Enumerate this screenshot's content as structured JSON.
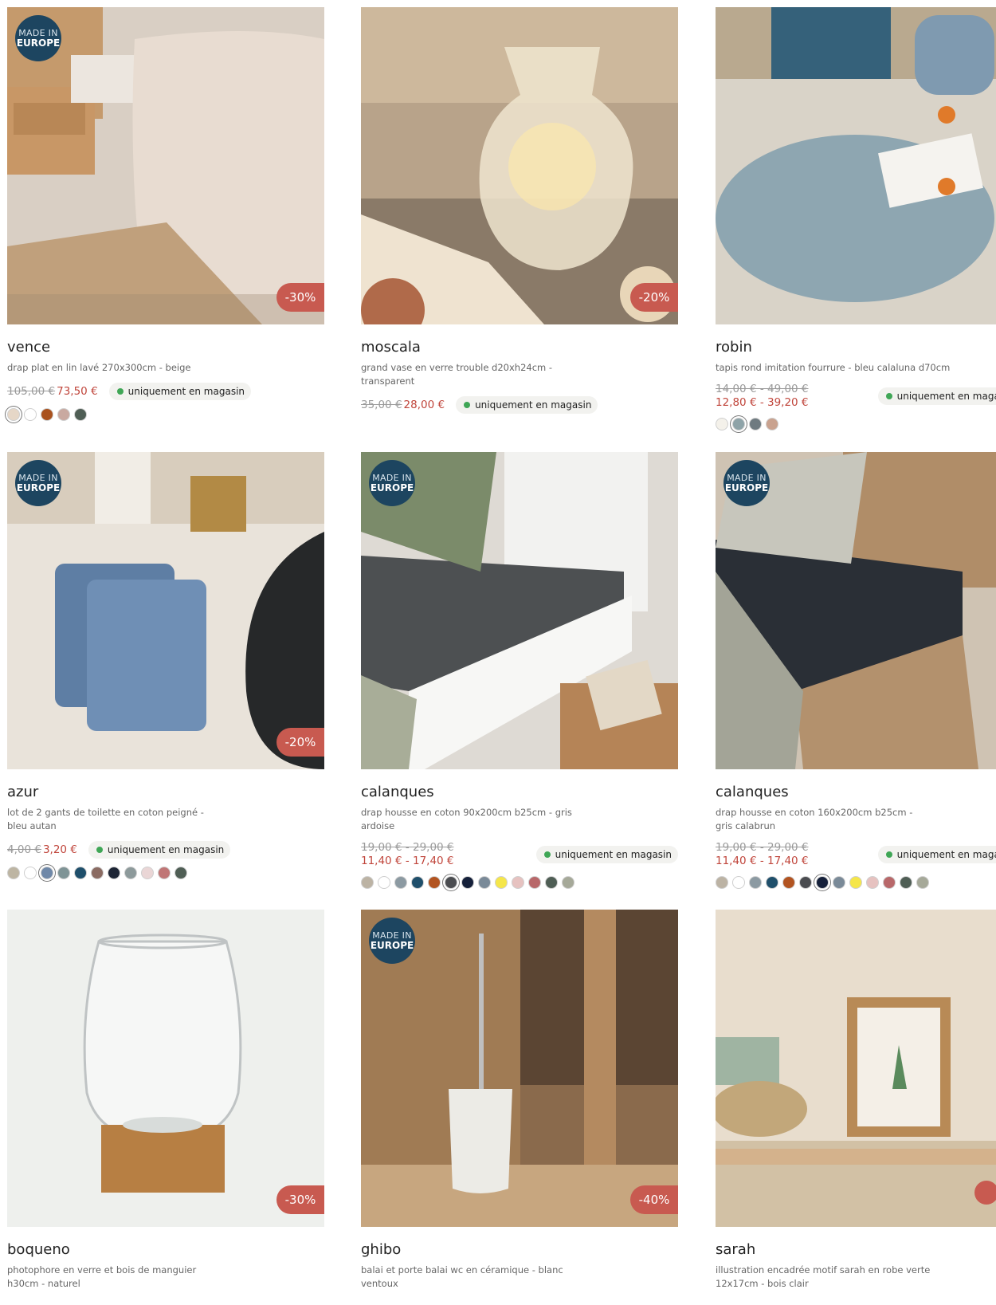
{
  "badges": {
    "made_line1": "MADE IN",
    "made_line2": "EUROPE"
  },
  "store_label": "uniquement en magasin",
  "products": [
    {
      "name": "vence",
      "desc": "drap plat en lin lavé 270x300cm - beige",
      "discount": "-30%",
      "old": "105,00 €",
      "new": "73,50 €",
      "made_in_europe": true,
      "store": true,
      "swatches": [
        "#e6d7c7",
        "#ffffff",
        "#a9521e",
        "#c9a9a0",
        "#4f5e55"
      ],
      "selected": 0
    },
    {
      "name": "moscala",
      "desc": "grand vase en verre trouble d20xh24cm - transparent",
      "discount": "-20%",
      "old": "35,00 €",
      "new": "28,00 €",
      "made_in_europe": false,
      "store": true,
      "swatches": []
    },
    {
      "name": "robin",
      "desc": "tapis rond imitation fourrure - bleu calaluna d70cm",
      "discount": "",
      "old": "14,00 € - 49,00 €",
      "new": "12,80 € - 39,20 €",
      "made_in_europe": false,
      "store": true,
      "swatches": [
        "#f4f1ea",
        "#8ea3a8",
        "#6e7a80",
        "#c9a28f"
      ],
      "selected": 1
    },
    {
      "name": "azur",
      "desc": "lot de 2 gants de toilette en coton peigné - bleu autan",
      "discount": "-20%",
      "old": "4,00 €",
      "new": "3,20 €",
      "made_in_europe": true,
      "store": true,
      "swatches": [
        "#bdb5a3",
        "#ffffff",
        "#6f88a8",
        "#7f9496",
        "#1f4f6b",
        "#8a6b62",
        "#1d2535",
        "#8d9a9b",
        "#ead6d6",
        "#c07676",
        "#4f5e55"
      ],
      "selected": 2
    },
    {
      "name": "calanques",
      "desc": "drap housse en coton 90x200cm b25cm - gris ardoise",
      "discount": "",
      "old": "19,00 € - 29,00 €",
      "new": "11,40 € - 17,40 €",
      "made_in_europe": true,
      "store": true,
      "swatches": [
        "#bcb3a4",
        "#ffffff",
        "#8c9aa2",
        "#1f4f6b",
        "#b25421",
        "#4a4c50",
        "#15203a",
        "#7a8a98",
        "#f5e64a",
        "#e6c2c0",
        "#b8686a",
        "#4f5e55",
        "#a6a999"
      ],
      "selected": 5
    },
    {
      "name": "calanques",
      "desc": "drap housse en coton 160x200cm b25cm - gris calabrun",
      "discount": "",
      "old": "19,00 € - 29,00 €",
      "new": "11,40 € - 17,40 €",
      "made_in_europe": true,
      "store": true,
      "swatches": [
        "#bcb3a4",
        "#ffffff",
        "#8c9aa2",
        "#1f4f6b",
        "#b25421",
        "#4a4c50",
        "#15203a",
        "#7a8a98",
        "#f5e64a",
        "#e6c2c0",
        "#b8686a",
        "#4f5e55",
        "#a6a999"
      ],
      "selected": 6
    },
    {
      "name": "boqueno",
      "desc": "photophore en verre et bois de manguier h30cm - naturel",
      "discount": "-30%",
      "old": "",
      "new": "",
      "made_in_europe": false,
      "store": false,
      "swatches": []
    },
    {
      "name": "ghibo",
      "desc": "balai et porte balai wc en céramique - blanc ventoux",
      "discount": "-40%",
      "old": "",
      "new": "",
      "made_in_europe": true,
      "store": false,
      "swatches": []
    },
    {
      "name": "sarah",
      "desc": "illustration encadrée motif sarah en robe verte 12x17cm - bois clair",
      "discount": "",
      "old": "",
      "new": "",
      "made_in_europe": false,
      "store": false,
      "swatches": []
    }
  ]
}
